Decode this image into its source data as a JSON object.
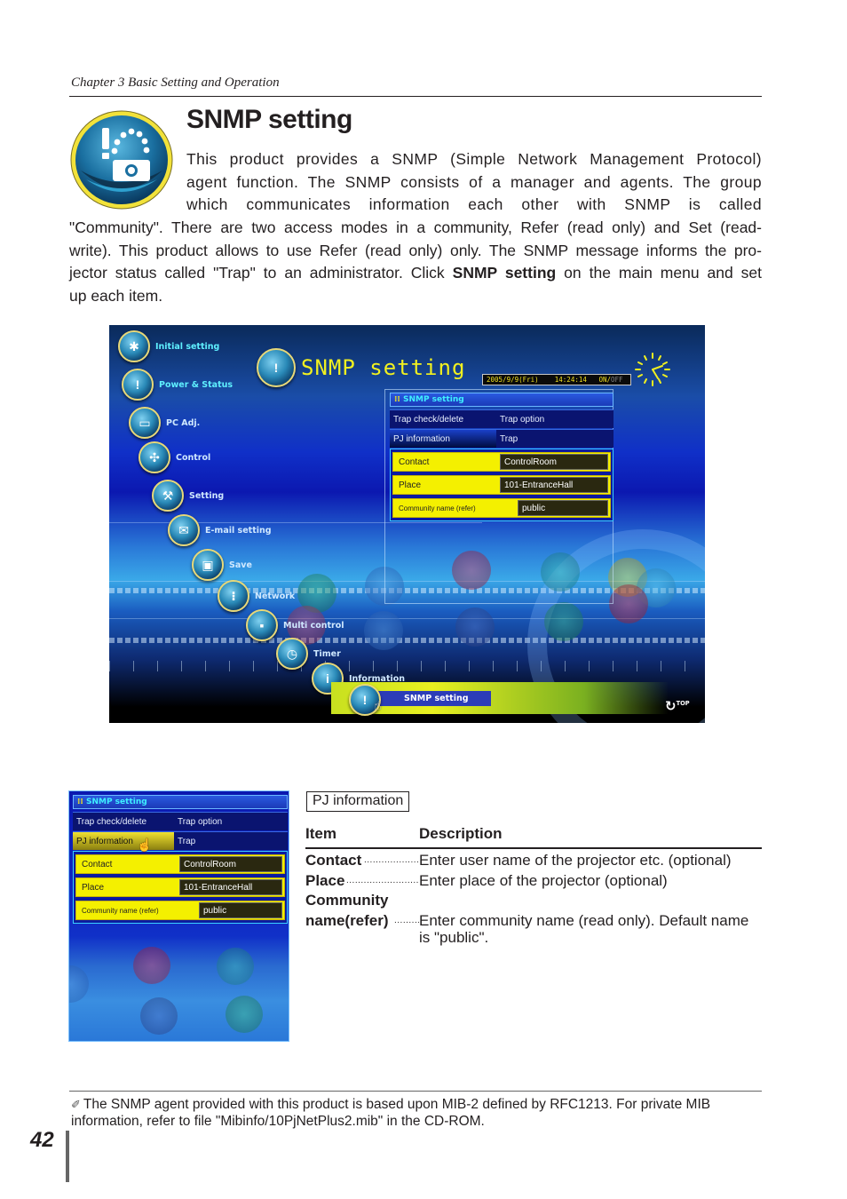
{
  "header": {
    "chapter": "Chapter 3 Basic Setting and Operation"
  },
  "section": {
    "icon": "snmp-projector-icon",
    "title": "SNMP setting",
    "intro_lines_a": [
      "This product provides a SNMP (Simple Network Management Protocol)",
      "agent function. The SNMP consists of a manager and agents. The group",
      "which communicates information each other with SNMP is called"
    ],
    "intro_lines_b": [
      "\"Community\". There are two access modes in a community, Refer (read only) and Set (read-",
      "write). This product allows to use Refer (read only) only. The SNMP message informs the pro-"
    ],
    "intro_line_c_pre": "jector status called \"Trap\" to an administrator. Click ",
    "intro_line_c_bold": "SNMP setting",
    "intro_line_c_post": " on the main menu and set",
    "intro_line_d": "up each item."
  },
  "screenshot": {
    "menu": [
      {
        "label": "Initial setting",
        "icon": "gear-projector-icon"
      },
      {
        "label": "Power & Status",
        "icon": "alert-projector-icon"
      },
      {
        "label": "PC Adj.",
        "icon": "monitor-pc-icon"
      },
      {
        "label": "Control",
        "icon": "directional-pad-icon"
      },
      {
        "label": "Setting",
        "icon": "wrench-screwdriver-icon"
      },
      {
        "label": "E-mail setting",
        "icon": "envelope-icon"
      },
      {
        "label": "Save",
        "icon": "floppy-disk-icon"
      },
      {
        "label": "Network",
        "icon": "network-projector-icon"
      },
      {
        "label": "Multi control",
        "icon": "multi-projector-icon"
      },
      {
        "label": "Timer",
        "icon": "clock-icon"
      },
      {
        "label": "Information",
        "icon": "info-icon"
      },
      {
        "label": "SNMP setting",
        "icon": "snmp-icon"
      }
    ],
    "page_heading": "SNMP setting",
    "status": {
      "date": "2005/9/9(Fri)",
      "time": "14:24:14",
      "on": "ON/",
      "off": "OFF"
    },
    "top_link": "TOP",
    "active_menu": "SNMP setting"
  },
  "panel": {
    "title": "SNMP setting",
    "tabs_row1": [
      "Trap check/delete",
      "Trap option"
    ],
    "tabs_row2": [
      "PJ information",
      "Trap"
    ],
    "active_tab": "PJ information",
    "fields": [
      {
        "label": "Contact",
        "value": "ControlRoom"
      },
      {
        "label": "Place",
        "value": "101-EntranceHall"
      },
      {
        "label": "Community name (refer)",
        "value": "public"
      }
    ]
  },
  "description": {
    "box_label": "PJ information",
    "col_item": "Item",
    "col_desc": "Description",
    "rows": [
      {
        "item": "Contact",
        "desc": "Enter user name of the projector etc. (optional)"
      },
      {
        "item": "Place",
        "desc": "Enter place of the projector (optional)"
      },
      {
        "item_line1": "Community",
        "item": "name(refer)",
        "desc": "Enter community name (read only). Default name is \"public\"."
      }
    ]
  },
  "footer": {
    "note": "The SNMP agent provided with this product is based upon MIB-2 defined by RFC1213. For private MIB information, refer to file \"Mibinfo/10PjNetPlus2.mib\" in the CD-ROM.",
    "page_number": "42"
  }
}
